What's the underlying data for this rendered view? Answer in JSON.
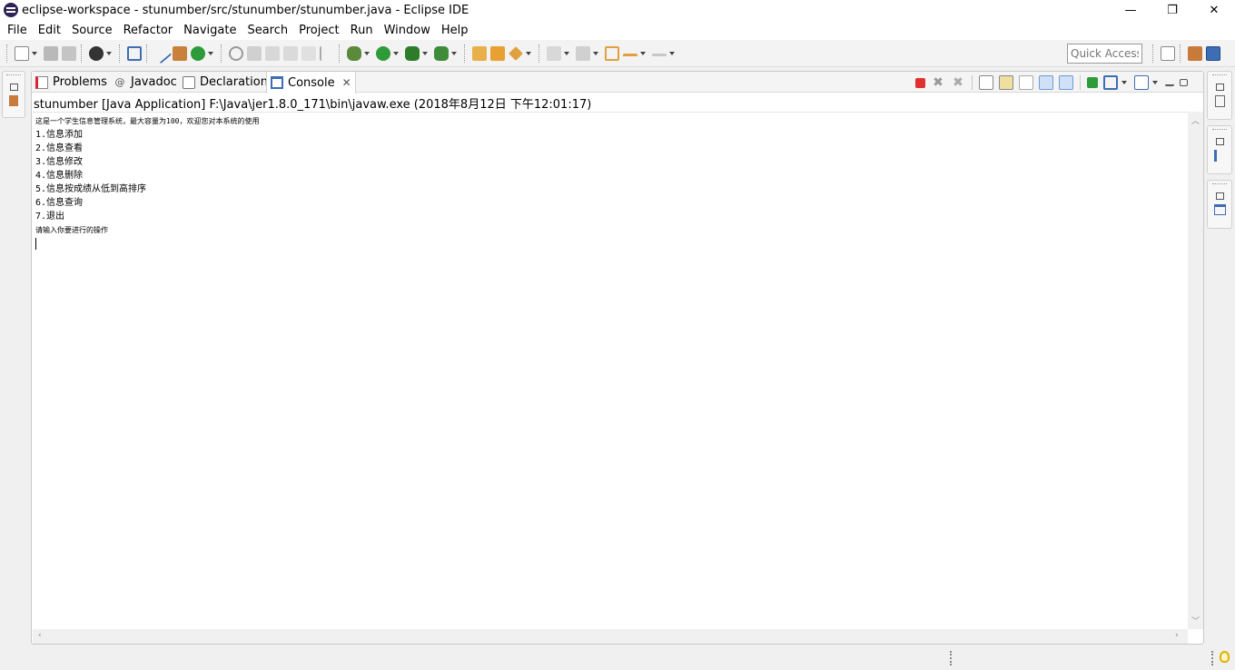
{
  "window": {
    "title": "eclipse-workspace - stunumber/src/stunumber/stunumber.java - Eclipse IDE",
    "minimize_glyph": "—",
    "restore_glyph": "❐",
    "close_glyph": "✕"
  },
  "menu": [
    "File",
    "Edit",
    "Source",
    "Refactor",
    "Navigate",
    "Search",
    "Project",
    "Run",
    "Window",
    "Help"
  ],
  "toolbar": {
    "quick_access_placeholder": "Quick Access"
  },
  "tabs": [
    {
      "label": "Problems",
      "active": false
    },
    {
      "label": "Javadoc",
      "active": false
    },
    {
      "label": "Declaration",
      "active": false
    },
    {
      "label": "Console",
      "active": true
    }
  ],
  "tab_close_glyph": "✕",
  "console": {
    "header": "stunumber [Java Application] F:\\Java\\jer1.8.0_171\\bin\\javaw.exe (2018年8月12日 下午12:01:17)",
    "lines": [
      "这是一个学生信息管理系统，最大容量为100，欢迎您对本系统的使用",
      "1.信息添加",
      "2.信息查看",
      "3.信息修改",
      "4.信息删除",
      "5.信息按成绩从低到高排序",
      "6.信息查询",
      "7.退出",
      "请输入你要进行的操作"
    ]
  },
  "colors": {
    "accent_blue": "#3c6db5",
    "terminate_red": "#e03030",
    "run_green": "#2e9b3a"
  },
  "icons": {
    "problems": "problems-icon",
    "javadoc": "at-sign-icon",
    "declaration": "declaration-icon",
    "console": "console-icon"
  }
}
